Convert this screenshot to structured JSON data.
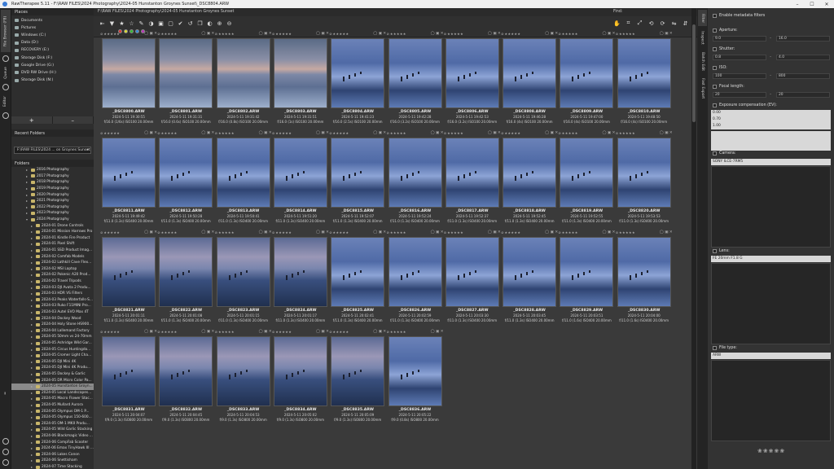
{
  "window": {
    "title": "RawTherapee 5.11 - F:\\RAW FILES\\2024 Photography\\2024-05 Hunstanton Groynes Sunset\\_DSC8804.ARW",
    "minimize": "–",
    "maximize": "☐",
    "close": "✕"
  },
  "left_tabs": {
    "file_browser": "File Browser (F8)",
    "queue": "Queue",
    "editor": "Editor"
  },
  "places": {
    "header": "Places",
    "items": [
      "Documents",
      "Pictures",
      "Windows (C:)",
      "Data (D:)",
      "RECOVERY (E:)",
      "Storage Disk (F:)",
      "Google Drive (G:)",
      "DVD RW Drive (H:)",
      "Storage Disk (N:)"
    ]
  },
  "place_buttons": {
    "add": "+",
    "remove": "–"
  },
  "recent": {
    "header": "Recent Folders",
    "value": "F:\\RAW FILES\\2024 ... on Groynes Sunset",
    "arrow": "▾"
  },
  "folders": {
    "header": "Folders",
    "items": [
      {
        "label": "2016 Photography",
        "level": 1
      },
      {
        "label": "2017 Photography",
        "level": 1
      },
      {
        "label": "2018 Photography",
        "level": 1
      },
      {
        "label": "2019 Photography",
        "level": 1
      },
      {
        "label": "2020 Photography",
        "level": 1
      },
      {
        "label": "2021 Photography",
        "level": 1
      },
      {
        "label": "2022 Photography",
        "level": 1
      },
      {
        "label": "2023 Photography",
        "level": 1
      },
      {
        "label": "2024 Photography",
        "level": 1,
        "open": true
      },
      {
        "label": "2024-01 Drone Controls",
        "level": 2
      },
      {
        "label": "2024-01 Mission Harrows Pro",
        "level": 2
      },
      {
        "label": "2024-01 Kindle Fire Product",
        "level": 2
      },
      {
        "label": "2024-01 Pixel Shift",
        "level": 2
      },
      {
        "label": "2024-01 SSD Product Imag...",
        "level": 2
      },
      {
        "label": "2024-02 Comfab Models",
        "level": 2
      },
      {
        "label": "2024-02 Lathkill Cave Flex...",
        "level": 2
      },
      {
        "label": "2024-02 MSI Laptop",
        "level": 2
      },
      {
        "label": "2024-02 Pokenic A20 Prod...",
        "level": 2
      },
      {
        "label": "2024-02 Travel Tripods",
        "level": 2
      },
      {
        "label": "2024-03 DJI Avata 2 Produ...",
        "level": 2
      },
      {
        "label": "2024-03 HDR VS Filters",
        "level": 2
      },
      {
        "label": "2024-03 Peaks Waterfalls-S...",
        "level": 2
      },
      {
        "label": "2024-03 Ruko F11MINI Pro...",
        "level": 2
      },
      {
        "label": "2024-03 Autel EVO Max 4T",
        "level": 2
      },
      {
        "label": "2024-04 Dockey Wood",
        "level": 2
      },
      {
        "label": "2024-04 Holy Stone HS900...",
        "level": 2
      },
      {
        "label": "2024-04 Lallemand Factory",
        "level": 2
      },
      {
        "label": "2024-05 50mm vs 24-70mm",
        "level": 2
      },
      {
        "label": "2024-05 Ashridge Wild Gar...",
        "level": 2
      },
      {
        "label": "2024-05 Circus Huntingdo...",
        "level": 2
      },
      {
        "label": "2024-05 Cromer Light Cha...",
        "level": 2
      },
      {
        "label": "2024-05 DJI Mini 4K",
        "level": 2
      },
      {
        "label": "2024-05 DJI Mini 4K Produ...",
        "level": 2
      },
      {
        "label": "2024-05 Dockey & Garlic",
        "level": 2
      },
      {
        "label": "2024-05 DR Micro Color Pa...",
        "level": 2
      },
      {
        "label": "2024-05 Hunstanton Groyn...",
        "level": 2,
        "selected": true
      },
      {
        "label": "2024-05 Local Landscapes...",
        "level": 2
      },
      {
        "label": "2024-05 Macro Flower Stac...",
        "level": 2
      },
      {
        "label": "2024-05 Mullard Aurora",
        "level": 2
      },
      {
        "label": "2024-05 Olympus OM-1 P...",
        "level": 2
      },
      {
        "label": "2024-05 Olympus 150-600...",
        "level": 2
      },
      {
        "label": "2024-05 OM-1 MKII Produ...",
        "level": 2
      },
      {
        "label": "2024-05 Wild Garlic Stacking",
        "level": 2
      },
      {
        "label": "2024-06 Blackmagic Video ...",
        "level": 2
      },
      {
        "label": "2024-06 CompFab Scooter",
        "level": 2
      },
      {
        "label": "2024-06 Emax TinyHawk III ...",
        "level": 2
      },
      {
        "label": "2024-06 Lakes Canon",
        "level": 2
      },
      {
        "label": "2024-06 Snettisham",
        "level": 2
      },
      {
        "label": "2024-07 Time Stacking",
        "level": 2
      }
    ]
  },
  "path": "F:\\RAW FILES\\2024 Photography\\2024-05 Hunstanton Groynes Sunset",
  "find_label": "Find:",
  "toolbar": {
    "icons": [
      "⇤",
      "▼",
      "★",
      "☆",
      "✎",
      "◑",
      "▣",
      "▢",
      "✔",
      "↺",
      "❐",
      "◐",
      "⊕",
      "⊖"
    ],
    "right_icons": [
      "✋",
      "⌗",
      "⤢",
      "⟲",
      "⟳",
      "⇋",
      "⇵"
    ]
  },
  "label_colors": [
    "#d33",
    "#dd3",
    "#3b3",
    "#38d",
    "#b3b"
  ],
  "thumbnails": [
    {
      "name": "_DSC8800.ARW",
      "date": "2024-5-11 19:30:55",
      "exif": "f/16.0 (1/6s) ISO100 20.00mm",
      "tone": "sunset"
    },
    {
      "name": "_DSC8801.ARW",
      "date": "2024-5-11 19:31:31",
      "exif": "f/16.0 (0.6s) ISO100 20.00mm",
      "tone": "sunset"
    },
    {
      "name": "_DSC8802.ARW",
      "date": "2024-5-11 19:31:42",
      "exif": "f/16.0 (0.8s) ISO100 20.00mm",
      "tone": "sunset"
    },
    {
      "name": "_DSC8803.ARW",
      "date": "2024-5-11 19:31:51",
      "exif": "f/16.0 (1s) ISO100 20.00mm",
      "tone": "sunset"
    },
    {
      "name": "_DSC8804.ARW",
      "date": "2024-5-11 19:41:23",
      "exif": "f/16.0 (2.5s) ISO100 20.00mm",
      "tone": "blue"
    },
    {
      "name": "_DSC8805.ARW",
      "date": "2024-5-11 19:42:28",
      "exif": "f/16.0 (3.2s) ISO100 20.00mm",
      "tone": "blue"
    },
    {
      "name": "_DSC8806.ARW",
      "date": "2024-5-11 19:42:53",
      "exif": "f/16.0 (3.2s) ISO100 20.00mm",
      "tone": "blue"
    },
    {
      "name": "_DSC8808.ARW",
      "date": "2024-5-11 19:46:28",
      "exif": "f/16.0 (4s) ISO100 20.00mm",
      "tone": "blue"
    },
    {
      "name": "_DSC8809.ARW",
      "date": "2024-5-11 19:47:00",
      "exif": "f/16.0 (4s) ISO100 20.00mm",
      "tone": "blue"
    },
    {
      "name": "_DSC8810.ARW",
      "date": "2024-5-11 19:48:50",
      "exif": "f/16.0 (4s) ISO100 20.00mm",
      "tone": "blue"
    },
    {
      "name": "_DSC8811.ARW",
      "date": "2024-5-11 19:49:42",
      "exif": "f/11.0 (1.3s) ISO400 20.00mm",
      "tone": "blue"
    },
    {
      "name": "_DSC8812.ARW",
      "date": "2024-5-11 19:50:28",
      "exif": "f/11.0 (1.3s) ISO400 20.00mm",
      "tone": "blue"
    },
    {
      "name": "_DSC8813.ARW",
      "date": "2024-5-11 19:50:41",
      "exif": "f/11.0 (1.3s) ISO400 20.00mm",
      "tone": "blue"
    },
    {
      "name": "_DSC8814.ARW",
      "date": "2024-5-11 19:51:20",
      "exif": "f/11.0 (1.3s) ISO400 20.00mm",
      "tone": "blue"
    },
    {
      "name": "_DSC8815.ARW",
      "date": "2024-5-11 19:52:07",
      "exif": "f/11.0 (1.3s) ISO400 20.00mm",
      "tone": "blue"
    },
    {
      "name": "_DSC8816.ARW",
      "date": "2024-5-11 19:52:24",
      "exif": "f/11.0 (1.3s) ISO400 20.00mm",
      "tone": "blue"
    },
    {
      "name": "_DSC8817.ARW",
      "date": "2024-5-11 19:52:37",
      "exif": "f/11.0 (1.3s) ISO400 20.00mm",
      "tone": "blue"
    },
    {
      "name": "_DSC8818.ARW",
      "date": "2024-5-11 19:52:45",
      "exif": "f/11.0 (1.3s) ISO400 20.00mm",
      "tone": "blue"
    },
    {
      "name": "_DSC8819.ARW",
      "date": "2024-5-11 19:52:55",
      "exif": "f/11.0 (1.3s) ISO400 20.00mm",
      "tone": "blue"
    },
    {
      "name": "_DSC8820.ARW",
      "date": "2024-5-11 19:53:53",
      "exif": "f/11.0 (1.3s) ISO400 20.00mm",
      "tone": "blue"
    },
    {
      "name": "_DSC8821.ARW",
      "date": "2024-5-11 20:01:11",
      "exif": "f/11.0 (1.3s) ISO400 20.00mm",
      "tone": "dusk"
    },
    {
      "name": "_DSC8822.ARW",
      "date": "2024-5-11 20:01:08",
      "exif": "f/11.0 (1.3s) ISO400 20.00mm",
      "tone": "dusk"
    },
    {
      "name": "_DSC8823.ARW",
      "date": "2024-5-11 20:01:15",
      "exif": "f/11.0 (1.3s) ISO400 20.00mm",
      "tone": "dusk"
    },
    {
      "name": "_DSC8824.ARW",
      "date": "2024-5-11 20:01:17",
      "exif": "f/11.0 (1.3s) ISO400 20.00mm",
      "tone": "dusk"
    },
    {
      "name": "_DSC8825.ARW",
      "date": "2024-5-11 20:02:41",
      "exif": "f/11.0 (1.3s) ISO400 20.00mm",
      "tone": "blue"
    },
    {
      "name": "_DSC8826.ARW",
      "date": "2024-5-11 20:02:59",
      "exif": "f/11.0 (1.3s) ISO400 20.00mm",
      "tone": "blue"
    },
    {
      "name": "_DSC8827.ARW",
      "date": "2024-5-11 20:03:30",
      "exif": "f/11.0 (1.3s) ISO400 20.00mm",
      "tone": "blue"
    },
    {
      "name": "_DSC8828.ARW",
      "date": "2024-5-11 20:03:45",
      "exif": "f/11.0 (1.3s) ISO400 20.00mm",
      "tone": "blue"
    },
    {
      "name": "_DSC8829.ARW",
      "date": "2024-5-11 20:03:51",
      "exif": "f/11.0 (1.6s) ISO400 20.00mm",
      "tone": "blue"
    },
    {
      "name": "_DSC8830.ARW",
      "date": "2024-5-11 20:04:00",
      "exif": "f/11.0 (1.6s) ISO400 20.00mm",
      "tone": "blue"
    },
    {
      "name": "_DSC8831.ARW",
      "date": "2024-5-11 20:04:07",
      "exif": "f/9.0 (1.3s) ISO800 20.00mm",
      "tone": "dusk"
    },
    {
      "name": "_DSC8832.ARW",
      "date": "2024-5-11 20:04:45",
      "exif": "f/9.0 (1.3s) ISO800 20.00mm",
      "tone": "dusk"
    },
    {
      "name": "_DSC8833.ARW",
      "date": "2024-5-11 20:04:53",
      "exif": "f/9.0 (1.3s) ISO800 20.00mm",
      "tone": "dusk"
    },
    {
      "name": "_DSC8834.ARW",
      "date": "2024-5-11 20:05:02",
      "exif": "f/9.0 (1.3s) ISO800 20.00mm",
      "tone": "dusk"
    },
    {
      "name": "_DSC8835.ARW",
      "date": "2024-5-11 20:05:09",
      "exif": "f/9.0 (1.3s) ISO800 20.00mm",
      "tone": "dusk"
    },
    {
      "name": "_DSC8836.ARW",
      "date": "2024-5-11 20:05:22",
      "exif": "f/9.0 (0.8s) ISO800 20.00mm",
      "tone": "blue"
    }
  ],
  "right_tabs": {
    "filter": "Filter",
    "inspect": "Inspect",
    "batch_edit": "Batch Edit",
    "fast_export": "Fast Export"
  },
  "filters": {
    "enable_metadata": "Enable metadata filters",
    "aperture": {
      "label": "Aperture:",
      "min": "9.0",
      "max": "16.0"
    },
    "shutter": {
      "label": "Shutter:",
      "min": "0.8",
      "max": "4.0"
    },
    "iso": {
      "label": "ISO:",
      "min": "100",
      "max": "800"
    },
    "focal": {
      "label": "Focal length:",
      "min": "20",
      "max": "20"
    },
    "exposure_comp": {
      "label": "Exposure compensation (EV):",
      "values": [
        "0.00",
        "0.70",
        "1.00"
      ]
    },
    "camera": {
      "label": "Camera:",
      "values": [
        "SONY ILCE-7RM5"
      ]
    },
    "lens": {
      "label": "Lens:",
      "values": [
        "FE 20mm F1.8 G"
      ]
    },
    "file_type": {
      "label": "File type:",
      "values": [
        "ARW"
      ]
    }
  },
  "logo_text": "❀❀❀❀❀"
}
